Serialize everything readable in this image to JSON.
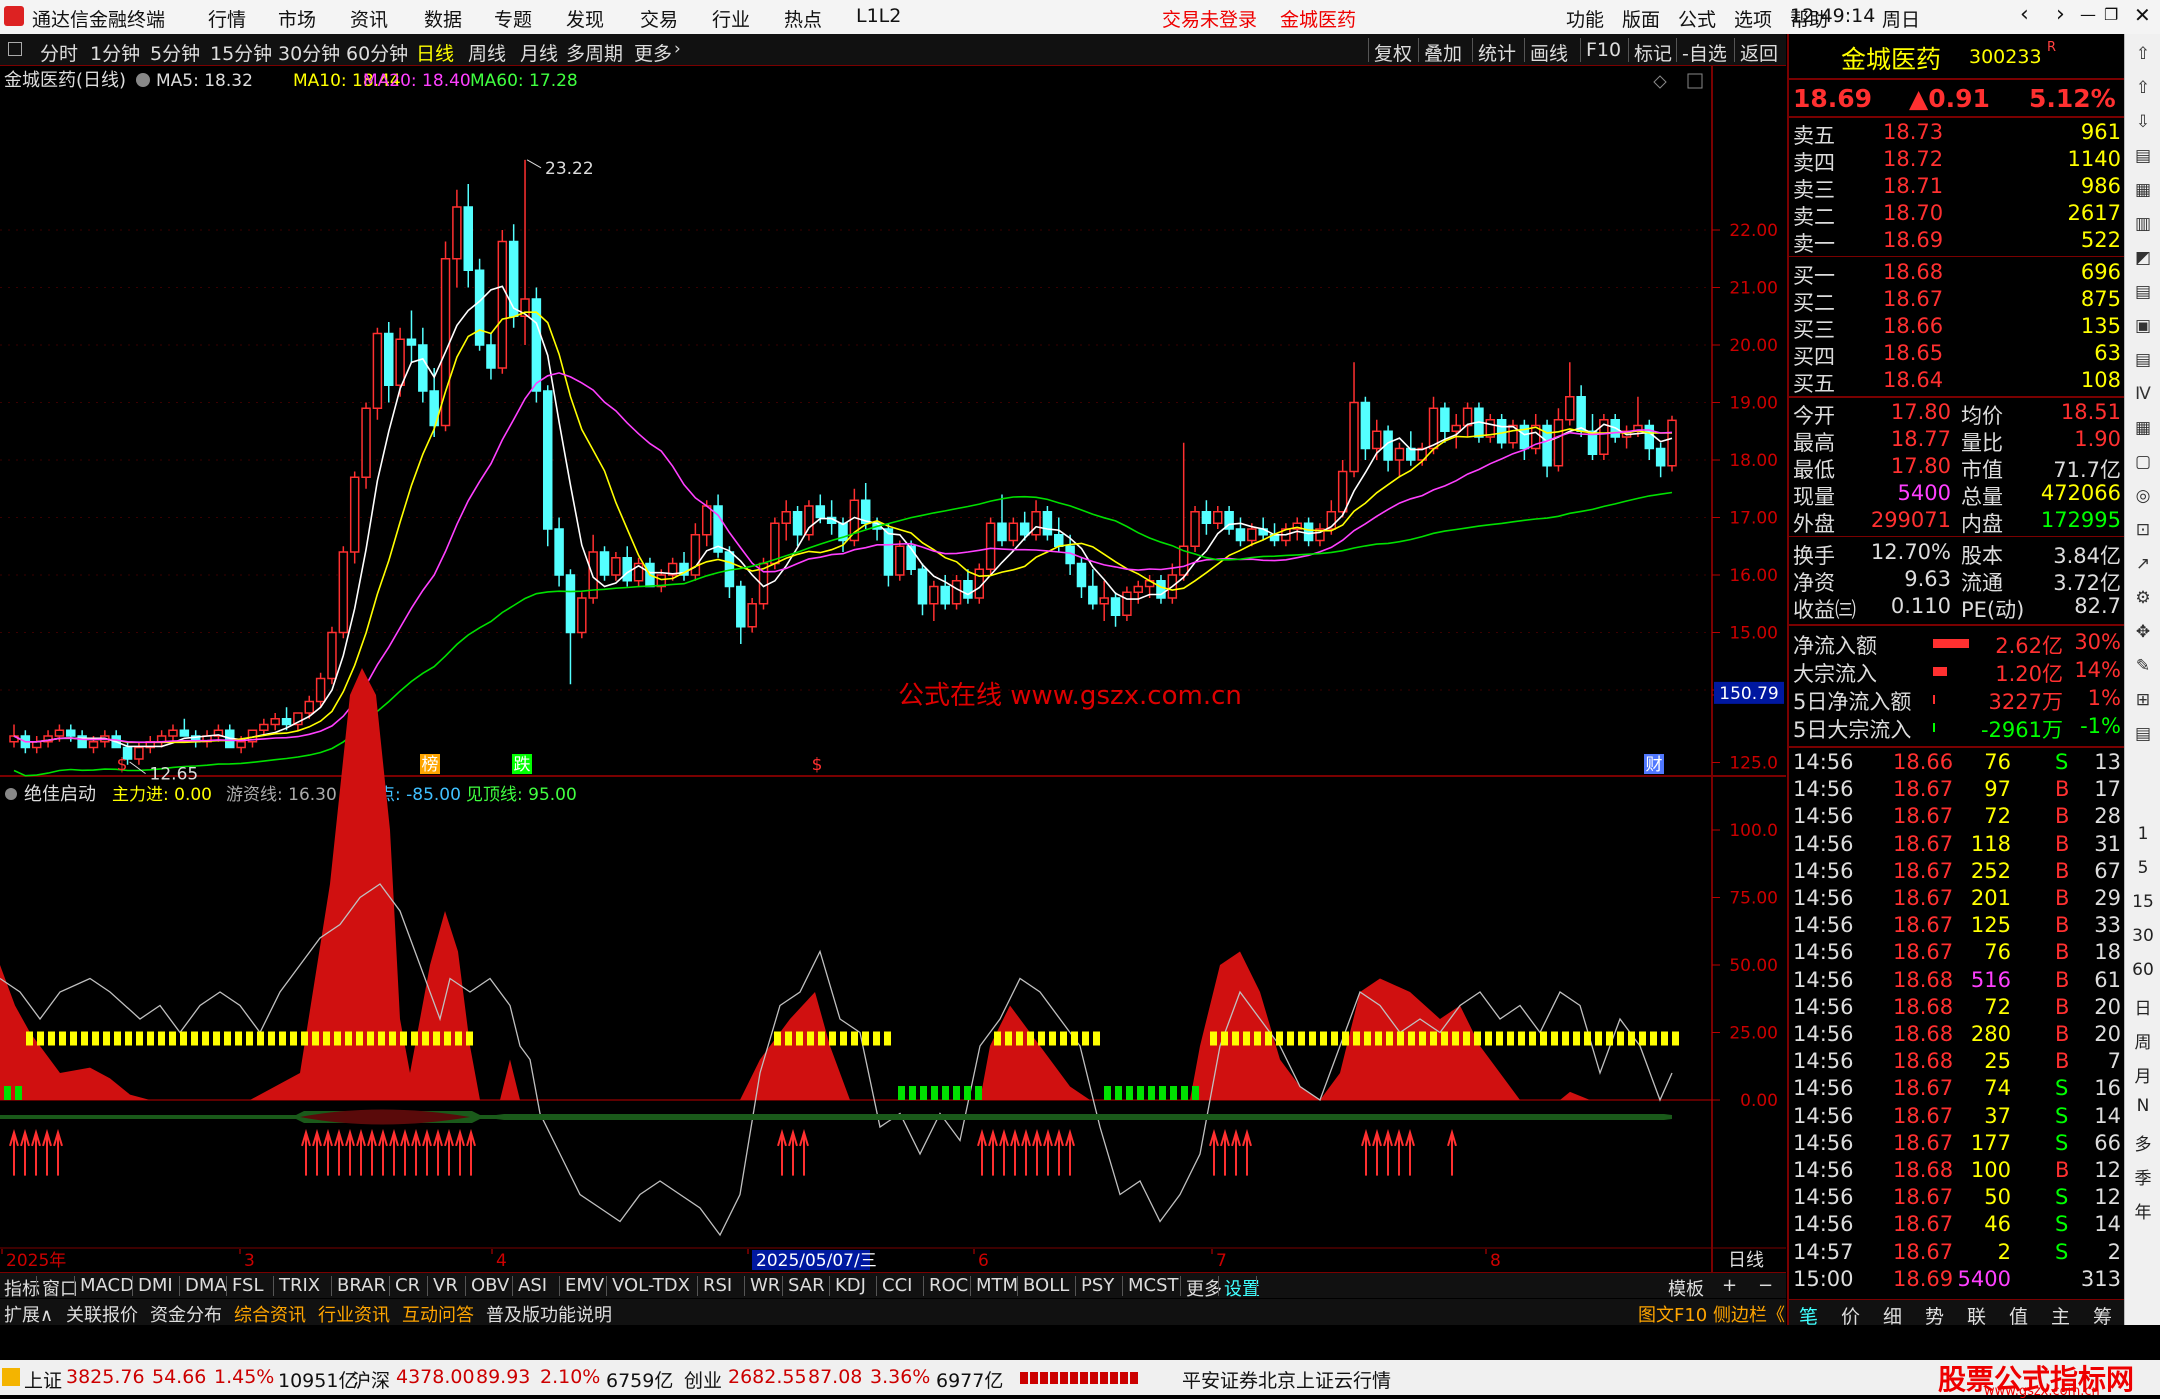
{
  "titlebar": {
    "app": "通达信金融终端",
    "menus": [
      "行情",
      "市场",
      "资讯",
      "数据",
      "专题",
      "发现",
      "交易",
      "行业",
      "热点",
      "L1L2"
    ],
    "trade_status": "交易未登录",
    "stock": "金城医药",
    "right_menus": [
      "功能",
      "版面",
      "公式",
      "选项",
      "帮助"
    ],
    "time": "12:49:14",
    "weekday": "周日"
  },
  "timeframes": [
    "分时",
    "1分钟",
    "5分钟",
    "15分钟",
    "30分钟",
    "60分钟",
    "日线",
    "周线",
    "月线",
    "多周期",
    "更多"
  ],
  "active_timeframe": "日线",
  "tools": [
    "复权",
    "叠加",
    "统计",
    "画线",
    "F10",
    "标记",
    "-自选",
    "返回"
  ],
  "chart_header": {
    "name": "金城医药(日线)",
    "ma5": "MA5: 18.32",
    "ma10": "MA10: 18.44",
    "ma20": "MA20: 18.40",
    "ma60": "MA60: 17.28"
  },
  "chart_data": {
    "type": "candlestick",
    "y_ticks": [
      "22.00",
      "21.00",
      "20.00",
      "19.00",
      "18.00",
      "17.00",
      "16.00",
      "15.00",
      "14.00"
    ],
    "annotations": {
      "high": "23.22",
      "low": "12.65",
      "watermark": "公式在线  www.gszx.com.cn"
    },
    "markers": [
      "$",
      "榜",
      "跌",
      "$",
      "财"
    ],
    "candles": [
      [
        13.1,
        13.4,
        13.0,
        13.2
      ],
      [
        13.2,
        13.3,
        12.9,
        13.0
      ],
      [
        13.0,
        13.2,
        12.9,
        13.1
      ],
      [
        13.1,
        13.3,
        13.0,
        13.2
      ],
      [
        13.2,
        13.4,
        13.1,
        13.3
      ],
      [
        13.3,
        13.4,
        13.1,
        13.2
      ],
      [
        13.2,
        13.3,
        13.0,
        13.0
      ],
      [
        13.0,
        13.2,
        12.9,
        13.1
      ],
      [
        13.1,
        13.3,
        13.0,
        13.2
      ],
      [
        13.2,
        13.3,
        13.0,
        13.0
      ],
      [
        13.0,
        13.1,
        12.7,
        12.8
      ],
      [
        12.8,
        13.1,
        12.7,
        13.0
      ],
      [
        13.0,
        13.2,
        12.9,
        13.1
      ],
      [
        13.1,
        13.3,
        13.0,
        13.2
      ],
      [
        13.2,
        13.4,
        13.1,
        13.3
      ],
      [
        13.3,
        13.5,
        13.2,
        13.2
      ],
      [
        13.2,
        13.3,
        13.0,
        13.1
      ],
      [
        13.1,
        13.3,
        13.0,
        13.2
      ],
      [
        13.2,
        13.4,
        13.1,
        13.3
      ],
      [
        13.3,
        13.4,
        13.0,
        13.0
      ],
      [
        13.0,
        13.2,
        12.9,
        13.1
      ],
      [
        13.1,
        13.3,
        13.0,
        13.3
      ],
      [
        13.3,
        13.5,
        13.2,
        13.4
      ],
      [
        13.4,
        13.6,
        13.3,
        13.5
      ],
      [
        13.5,
        13.7,
        13.3,
        13.4
      ],
      [
        13.4,
        13.6,
        13.3,
        13.6
      ],
      [
        13.6,
        13.9,
        13.5,
        13.8
      ],
      [
        13.8,
        14.3,
        13.7,
        14.2
      ],
      [
        14.2,
        15.1,
        14.1,
        15.0
      ],
      [
        15.0,
        16.5,
        14.9,
        16.4
      ],
      [
        16.4,
        17.8,
        16.2,
        17.7
      ],
      [
        17.7,
        19.0,
        17.5,
        18.9
      ],
      [
        18.9,
        20.3,
        18.7,
        20.2
      ],
      [
        20.2,
        20.4,
        19.0,
        19.3
      ],
      [
        19.3,
        20.3,
        19.1,
        20.1
      ],
      [
        20.1,
        20.6,
        19.7,
        20.0
      ],
      [
        20.0,
        20.3,
        19.0,
        19.2
      ],
      [
        19.2,
        19.6,
        18.4,
        18.6
      ],
      [
        18.6,
        21.8,
        18.5,
        21.5
      ],
      [
        21.5,
        22.7,
        21.0,
        22.4
      ],
      [
        22.4,
        22.8,
        21.0,
        21.3
      ],
      [
        21.3,
        21.5,
        19.9,
        20.0
      ],
      [
        20.0,
        20.2,
        19.4,
        19.6
      ],
      [
        19.6,
        22.0,
        19.5,
        21.8
      ],
      [
        21.8,
        22.1,
        20.3,
        20.5
      ],
      [
        20.5,
        23.22,
        20.0,
        20.8
      ],
      [
        20.8,
        21.0,
        19.0,
        19.2
      ],
      [
        19.2,
        19.3,
        16.5,
        16.8
      ],
      [
        16.8,
        17.0,
        15.8,
        16.0
      ],
      [
        16.0,
        16.1,
        14.1,
        15.0
      ],
      [
        15.0,
        15.7,
        14.9,
        15.6
      ],
      [
        15.6,
        16.7,
        15.5,
        16.4
      ],
      [
        16.4,
        16.5,
        15.9,
        16.0
      ],
      [
        16.0,
        16.4,
        15.9,
        16.3
      ],
      [
        16.3,
        16.5,
        15.8,
        15.9
      ],
      [
        15.9,
        16.3,
        15.8,
        16.2
      ],
      [
        16.2,
        16.3,
        15.8,
        15.8
      ],
      [
        15.8,
        16.1,
        15.7,
        16.0
      ],
      [
        16.0,
        16.3,
        15.9,
        16.2
      ],
      [
        16.2,
        16.4,
        15.9,
        16.0
      ],
      [
        16.0,
        16.9,
        15.9,
        16.7
      ],
      [
        16.7,
        17.3,
        16.5,
        17.2
      ],
      [
        17.2,
        17.4,
        16.3,
        16.4
      ],
      [
        16.4,
        16.5,
        15.6,
        15.8
      ],
      [
        15.8,
        15.9,
        14.8,
        15.1
      ],
      [
        15.1,
        15.6,
        15.0,
        15.5
      ],
      [
        15.5,
        16.3,
        15.4,
        16.2
      ],
      [
        16.2,
        17.0,
        16.1,
        16.9
      ],
      [
        16.9,
        17.3,
        16.6,
        17.1
      ],
      [
        17.1,
        17.2,
        16.5,
        16.7
      ],
      [
        16.7,
        17.3,
        16.6,
        17.2
      ],
      [
        17.2,
        17.4,
        16.9,
        17.0
      ],
      [
        17.0,
        17.3,
        16.7,
        16.9
      ],
      [
        16.9,
        17.0,
        16.4,
        16.6
      ],
      [
        16.6,
        17.5,
        16.5,
        17.3
      ],
      [
        17.3,
        17.6,
        16.8,
        16.9
      ],
      [
        16.9,
        17.0,
        16.6,
        16.8
      ],
      [
        16.8,
        16.9,
        15.8,
        16.0
      ],
      [
        16.0,
        16.6,
        15.9,
        16.5
      ],
      [
        16.5,
        16.6,
        16.0,
        16.1
      ],
      [
        16.1,
        16.2,
        15.3,
        15.5
      ],
      [
        15.5,
        15.9,
        15.2,
        15.8
      ],
      [
        15.8,
        16.0,
        15.4,
        15.5
      ],
      [
        15.5,
        16.0,
        15.4,
        15.9
      ],
      [
        15.9,
        16.1,
        15.5,
        15.6
      ],
      [
        15.6,
        16.2,
        15.5,
        16.1
      ],
      [
        16.1,
        17.0,
        16.0,
        16.9
      ],
      [
        16.9,
        17.4,
        16.5,
        16.6
      ],
      [
        16.6,
        17.0,
        16.5,
        16.9
      ],
      [
        16.9,
        17.1,
        16.6,
        16.7
      ],
      [
        16.7,
        17.3,
        16.6,
        17.1
      ],
      [
        17.1,
        17.2,
        16.6,
        16.7
      ],
      [
        16.7,
        17.0,
        16.4,
        16.5
      ],
      [
        16.5,
        16.7,
        16.0,
        16.2
      ],
      [
        16.2,
        16.3,
        15.6,
        15.8
      ],
      [
        15.8,
        16.1,
        15.4,
        15.5
      ],
      [
        15.5,
        15.9,
        15.2,
        15.6
      ],
      [
        15.6,
        15.7,
        15.1,
        15.3
      ],
      [
        15.3,
        15.8,
        15.2,
        15.7
      ],
      [
        15.7,
        15.9,
        15.5,
        15.8
      ],
      [
        15.8,
        16.0,
        15.6,
        15.9
      ],
      [
        15.9,
        16.0,
        15.5,
        15.6
      ],
      [
        15.6,
        16.2,
        15.5,
        16.0
      ],
      [
        16.0,
        18.3,
        15.9,
        16.5
      ],
      [
        16.5,
        17.2,
        16.4,
        17.1
      ],
      [
        17.1,
        17.3,
        16.7,
        16.9
      ],
      [
        16.9,
        17.2,
        16.8,
        17.1
      ],
      [
        17.1,
        17.2,
        16.7,
        16.8
      ],
      [
        16.8,
        17.0,
        16.5,
        16.6
      ],
      [
        16.6,
        16.9,
        16.5,
        16.8
      ],
      [
        16.8,
        17.0,
        16.6,
        16.7
      ],
      [
        16.7,
        16.9,
        16.5,
        16.6
      ],
      [
        16.6,
        16.9,
        16.5,
        16.8
      ],
      [
        16.8,
        17.0,
        16.6,
        16.9
      ],
      [
        16.9,
        17.0,
        16.5,
        16.6
      ],
      [
        16.6,
        16.9,
        16.5,
        16.8
      ],
      [
        16.8,
        17.3,
        16.7,
        17.1
      ],
      [
        17.1,
        18.0,
        17.0,
        17.8
      ],
      [
        17.8,
        19.7,
        17.7,
        19.0
      ],
      [
        19.0,
        19.1,
        18.0,
        18.2
      ],
      [
        18.2,
        18.7,
        18.0,
        18.5
      ],
      [
        18.5,
        18.6,
        17.8,
        18.0
      ],
      [
        18.0,
        18.3,
        17.7,
        18.2
      ],
      [
        18.2,
        18.5,
        17.9,
        18.0
      ],
      [
        18.0,
        18.3,
        17.9,
        18.2
      ],
      [
        18.2,
        19.1,
        18.1,
        18.9
      ],
      [
        18.9,
        19.0,
        18.3,
        18.5
      ],
      [
        18.5,
        18.8,
        18.2,
        18.6
      ],
      [
        18.6,
        19.0,
        18.4,
        18.9
      ],
      [
        18.9,
        19.0,
        18.3,
        18.4
      ],
      [
        18.4,
        18.8,
        18.3,
        18.7
      ],
      [
        18.7,
        18.8,
        18.2,
        18.3
      ],
      [
        18.3,
        18.7,
        18.2,
        18.6
      ],
      [
        18.6,
        18.7,
        18.0,
        18.2
      ],
      [
        18.2,
        18.8,
        18.1,
        18.6
      ],
      [
        18.6,
        18.7,
        17.7,
        17.9
      ],
      [
        17.9,
        18.9,
        17.8,
        18.7
      ],
      [
        18.7,
        19.7,
        18.6,
        19.1
      ],
      [
        19.1,
        19.3,
        18.4,
        18.5
      ],
      [
        18.5,
        18.8,
        18.0,
        18.1
      ],
      [
        18.1,
        18.8,
        18.0,
        18.7
      ],
      [
        18.7,
        18.8,
        18.3,
        18.4
      ],
      [
        18.4,
        18.6,
        18.2,
        18.5
      ],
      [
        18.5,
        19.1,
        18.4,
        18.6
      ],
      [
        18.6,
        18.7,
        18.0,
        18.2
      ],
      [
        18.2,
        18.3,
        17.7,
        17.9
      ],
      [
        17.9,
        18.77,
        17.8,
        18.69
      ]
    ]
  },
  "indicator": {
    "name": "绝佳启动",
    "main": "主力进: 0.00",
    "swim": "游资线: 16.30",
    "start": "启动点: -85.00",
    "top": "见顶线: 95.00",
    "value_tag": "150.79",
    "y_ticks": [
      "150.0",
      "125.0",
      "100.0",
      "75.00",
      "50.00",
      "25.00",
      "0.00"
    ]
  },
  "date_axis": {
    "labels": [
      "2025年",
      "3",
      "4",
      "5",
      "6",
      "7",
      "8"
    ],
    "cursor_date": "2025/05/07/三",
    "period": "日线"
  },
  "indicator_tabs": [
    "指标",
    "窗口",
    "MACD",
    "DMI",
    "DMA",
    "FSL",
    "TRIX",
    "BRAR",
    "CR",
    "VR",
    "OBV",
    "ASI",
    "EMV",
    "VOL-TDX",
    "RSI",
    "WR",
    "SAR",
    "KDJ",
    "CCI",
    "ROC",
    "MTM",
    "BOLL",
    "PSY",
    "MCST",
    "更多",
    "设置"
  ],
  "template_label": "模板",
  "bottom_tabs": [
    "扩展∧",
    "关联报价",
    "资金分布",
    "综合资讯",
    "行业资讯",
    "互动问答",
    "普及版功能说明"
  ],
  "bottom_right_label": "图文F10 侧边栏《",
  "quote": {
    "name": "金城医药",
    "code": "300233",
    "flag": "R",
    "price": "18.69",
    "change": "▲0.91",
    "pct": "5.12%",
    "asks": [
      [
        "卖五",
        "18.73",
        "961"
      ],
      [
        "卖四",
        "18.72",
        "1140"
      ],
      [
        "卖三",
        "18.71",
        "986"
      ],
      [
        "卖二",
        "18.70",
        "2617"
      ],
      [
        "卖一",
        "18.69",
        "522"
      ]
    ],
    "bids": [
      [
        "买一",
        "18.68",
        "696"
      ],
      [
        "买二",
        "18.67",
        "875"
      ],
      [
        "买三",
        "18.66",
        "135"
      ],
      [
        "买四",
        "18.65",
        "63"
      ],
      [
        "买五",
        "18.64",
        "108"
      ]
    ],
    "stats": [
      [
        "今开",
        "17.80",
        "均价",
        "18.51"
      ],
      [
        "最高",
        "18.77",
        "量比",
        "1.90"
      ],
      [
        "最低",
        "17.80",
        "市值",
        "71.7亿"
      ],
      [
        "现量",
        "5400",
        "总量",
        "472066"
      ],
      [
        "外盘",
        "299071",
        "内盘",
        "172995"
      ]
    ],
    "stats2": [
      [
        "换手",
        "12.70%",
        "股本",
        "3.84亿"
      ],
      [
        "净资",
        "9.63",
        "流通",
        "3.72亿"
      ],
      [
        "收益㈢",
        "0.110",
        "PE(动)",
        "82.7"
      ]
    ],
    "flows": [
      [
        "净流入额",
        "2.62亿",
        "30%"
      ],
      [
        "大宗流入",
        "1.20亿",
        "14%"
      ],
      [
        "5日净流入额",
        "3227万",
        "1%"
      ],
      [
        "5日大宗流入",
        "-2961万",
        "-1%"
      ]
    ]
  },
  "ticks": [
    [
      "14:56",
      "18.66",
      "76",
      "S",
      "13"
    ],
    [
      "14:56",
      "18.67",
      "97",
      "B",
      "17"
    ],
    [
      "14:56",
      "18.67",
      "72",
      "B",
      "28"
    ],
    [
      "14:56",
      "18.67",
      "118",
      "B",
      "31"
    ],
    [
      "14:56",
      "18.67",
      "252",
      "B",
      "67"
    ],
    [
      "14:56",
      "18.67",
      "201",
      "B",
      "29"
    ],
    [
      "14:56",
      "18.67",
      "125",
      "B",
      "33"
    ],
    [
      "14:56",
      "18.67",
      "76",
      "B",
      "18"
    ],
    [
      "14:56",
      "18.68",
      "516",
      "B",
      "61"
    ],
    [
      "14:56",
      "18.68",
      "72",
      "B",
      "20"
    ],
    [
      "14:56",
      "18.68",
      "280",
      "B",
      "20"
    ],
    [
      "14:56",
      "18.68",
      "25",
      "B",
      "7"
    ],
    [
      "14:56",
      "18.67",
      "74",
      "S",
      "16"
    ],
    [
      "14:56",
      "18.67",
      "37",
      "S",
      "14"
    ],
    [
      "14:56",
      "18.67",
      "177",
      "S",
      "66"
    ],
    [
      "14:56",
      "18.68",
      "100",
      "B",
      "12"
    ],
    [
      "14:56",
      "18.67",
      "50",
      "S",
      "12"
    ],
    [
      "14:56",
      "18.67",
      "46",
      "S",
      "14"
    ],
    [
      "14:57",
      "18.67",
      "2",
      "S",
      "2"
    ],
    [
      "15:00",
      "18.69",
      "5400",
      "",
      "313"
    ]
  ],
  "panel_tabs": [
    "笔",
    "价",
    "细",
    "势",
    "联",
    "值",
    "主",
    "筹"
  ],
  "sidebar_text": [
    "1",
    "5",
    "15",
    "30",
    "60",
    "日",
    "周",
    "月",
    "N",
    "多",
    "季",
    "年"
  ],
  "status": {
    "sh_name": "上证",
    "sh_val": "3825.76",
    "sh_chg": "54.66",
    "sh_pct": "1.45%",
    "sh_amt": "10951亿",
    "sz_name": "沪深",
    "sz_val": "4378.00",
    "sz_chg": "89.93",
    "sz_pct": "2.10%",
    "sz_amt": "6759亿",
    "cy_name": "创业",
    "cy_val": "2682.55",
    "cy_chg": "87.08",
    "cy_pct": "3.36%",
    "cy_amt": "6977亿",
    "broker": "平安证券北京上证云行情",
    "logo": "股票公式指标网",
    "logo_url": "www.gszx.com.cn"
  }
}
